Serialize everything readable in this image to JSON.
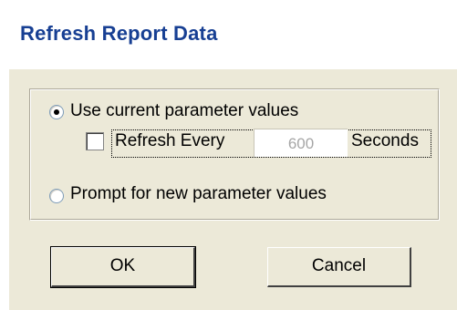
{
  "window": {
    "title": "Refresh Report Data"
  },
  "options": {
    "use_current": {
      "label": "Use current parameter values",
      "selected": true
    },
    "refresh_every": {
      "label": "Refresh Every",
      "checked": false,
      "value": "600",
      "unit": "Seconds"
    },
    "prompt_new": {
      "label": "Prompt for new parameter values",
      "selected": false
    }
  },
  "buttons": {
    "ok_label": "OK",
    "cancel_label": "Cancel"
  },
  "colors": {
    "title_text": "#173f93",
    "dialog_background": "#ece9d8",
    "disabled_text": "#a6a6a6"
  }
}
